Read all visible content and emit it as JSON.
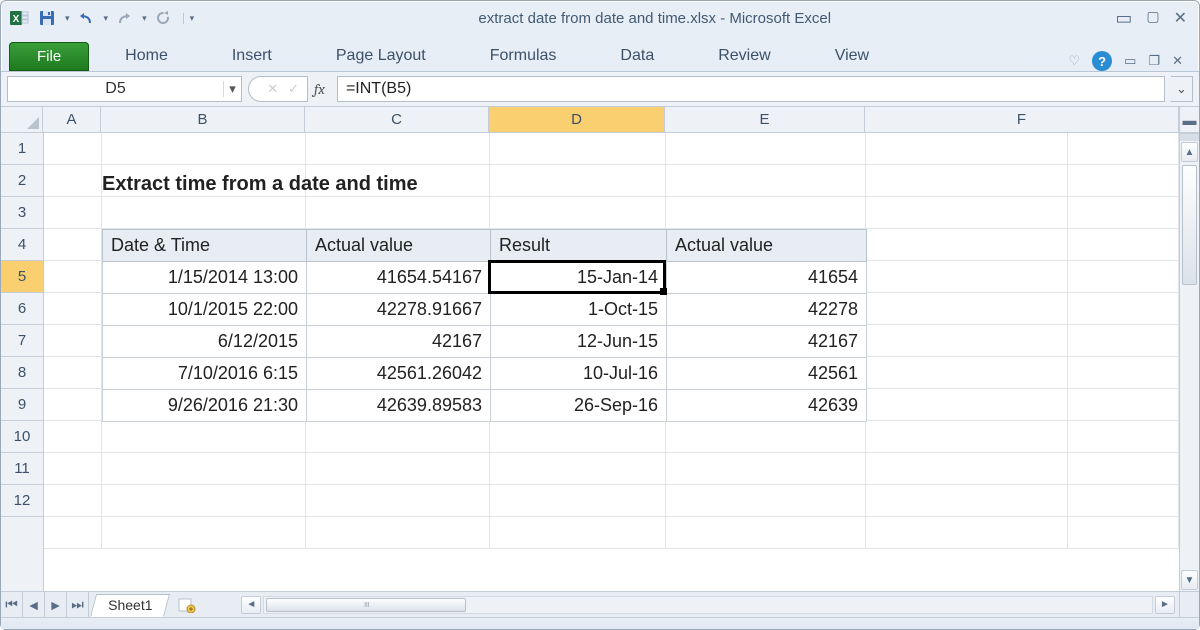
{
  "window": {
    "title": "extract date from date and time.xlsx  -  Microsoft Excel"
  },
  "qat": {
    "excel_icon": "excel-icon",
    "save": "save-icon",
    "undo": "undo-icon",
    "redo": "redo-icon",
    "repeat": "repeat-icon"
  },
  "ribbon": {
    "file": "File",
    "tabs": [
      "Home",
      "Insert",
      "Page Layout",
      "Formulas",
      "Data",
      "Review",
      "View"
    ]
  },
  "namebox": {
    "value": "D5"
  },
  "formula_bar": {
    "fx_label": "fx",
    "value": "=INT(B5)"
  },
  "columns": [
    "A",
    "B",
    "C",
    "D",
    "E",
    "F"
  ],
  "active_col_index": 3,
  "rows": [
    1,
    2,
    3,
    4,
    5,
    6,
    7,
    8,
    9,
    10,
    11,
    12
  ],
  "active_row_index": 4,
  "spreadsheet": {
    "title": "Extract time from a date and time",
    "headers": [
      "Date & Time",
      "Actual value",
      "Result",
      "Actual value"
    ],
    "data": [
      {
        "date_time": "1/15/2014 13:00",
        "actual1": "41654.54167",
        "result": "15-Jan-14",
        "actual2": "41654"
      },
      {
        "date_time": "10/1/2015 22:00",
        "actual1": "42278.91667",
        "result": "1-Oct-15",
        "actual2": "42278"
      },
      {
        "date_time": "6/12/2015",
        "actual1": "42167",
        "result": "12-Jun-15",
        "actual2": "42167"
      },
      {
        "date_time": "7/10/2016 6:15",
        "actual1": "42561.26042",
        "result": "10-Jul-16",
        "actual2": "42561"
      },
      {
        "date_time": "9/26/2016 21:30",
        "actual1": "42639.89583",
        "result": "26-Sep-16",
        "actual2": "42639"
      }
    ]
  },
  "sheet_tabs": {
    "active": "Sheet1"
  },
  "selection": {
    "col": "D",
    "row": 5
  },
  "colors": {
    "accent": "#1e7a1e",
    "col_active": "#f9cf6f"
  }
}
